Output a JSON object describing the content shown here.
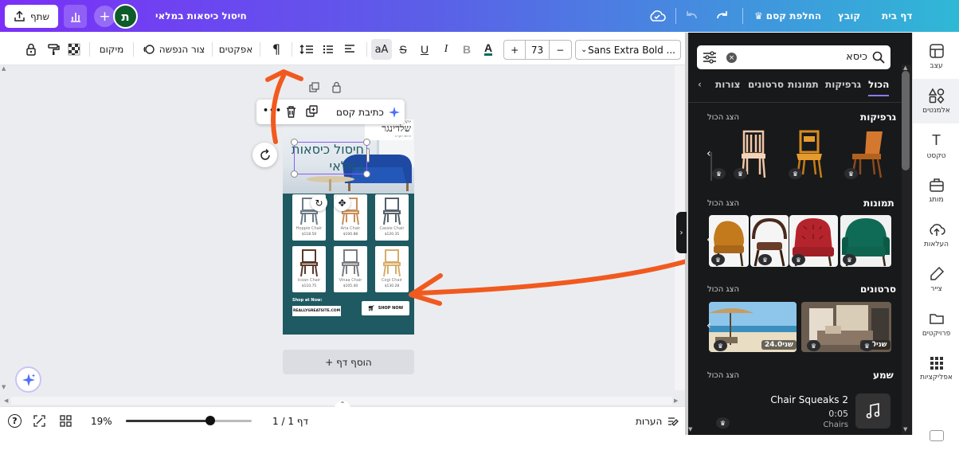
{
  "topbar": {
    "home": "דף בית",
    "file": "קובץ",
    "resize": "החלפת קסם",
    "doc_title": "חיסול כיסאות במלאי",
    "share": "שתף",
    "avatar_letter": "ת"
  },
  "toolbar": {
    "font_name": "Sans Extra Bold ...",
    "font_size": "73",
    "minus": "−",
    "plus": "+",
    "bold": "B",
    "italic": "I",
    "underline": "U",
    "strike": "S",
    "case": "aA",
    "effects": "אפקטים",
    "shape_label": "צור הנפשה",
    "position": "מיקום"
  },
  "canvas": {
    "context_magic": "כתיבת קסם",
    "context_more": "•••",
    "add_page": "+ הוסף דף",
    "design": {
      "brand": "שלדינגר",
      "brand_small": "רהיטי יוקרה",
      "brand_tag": "יוקרה",
      "headline_line1": "חיסול כיסאות",
      "headline_line2": "במלאי",
      "shop_at": "Shop at Now:",
      "site": "REALLYGREATSITE.COM",
      "shop_now": "SHOP NOW",
      "products": [
        {
          "name": "Cassie Chair",
          "price": "$120.35",
          "color": "#55606a"
        },
        {
          "name": "Aria Chair",
          "price": "$100.88",
          "color": "#c98f5a"
        },
        {
          "name": "Hoppie Chair",
          "price": "$118.50",
          "color": "#6d7a88"
        },
        {
          "name": "Cogi Chair",
          "price": "$130.28",
          "color": "#d6ad6b"
        },
        {
          "name": "Vinaa Chair",
          "price": "$105.40",
          "color": "#7a7d82"
        },
        {
          "name": "Icoan Chair",
          "price": "$110.75",
          "color": "#5b3a2a"
        }
      ]
    }
  },
  "bottombar": {
    "notes": "הערות",
    "page_indicator": "דף 1 / 1",
    "zoom": "19%",
    "zoom_level": 0.19
  },
  "panel": {
    "search_value": "כיסא",
    "tabs": [
      "הכול",
      "גרפיקות",
      "תמונות",
      "סרטונים",
      "צורות"
    ],
    "see_all": "הצג הכול",
    "sections": {
      "graphics": "גרפיקות",
      "photos": "תמונות",
      "videos": "סרטונים",
      "audio": "שמע"
    },
    "videos": [
      {
        "duration": "24.0שני"
      },
      {
        "duration": "8.0שני"
      }
    ],
    "audio": {
      "title": "Chair Squeaks 2",
      "duration": "0:05",
      "artist": "Chairs"
    }
  },
  "rail": [
    {
      "label": "עצב",
      "icon": "design-icon"
    },
    {
      "label": "אלמנטים",
      "icon": "elements-icon"
    },
    {
      "label": "טקסט",
      "icon": "text-icon"
    },
    {
      "label": "מותג",
      "icon": "brand-icon"
    },
    {
      "label": "העלאות",
      "icon": "upload-icon"
    },
    {
      "label": "צייר",
      "icon": "draw-icon"
    },
    {
      "label": "פרויקטים",
      "icon": "folder-icon"
    },
    {
      "label": "אפליקציות",
      "icon": "apps-icon"
    }
  ],
  "colors": {
    "annotation": "#f15a1f",
    "design_bg": "#1f5a62",
    "headline": "#1f5a62"
  }
}
